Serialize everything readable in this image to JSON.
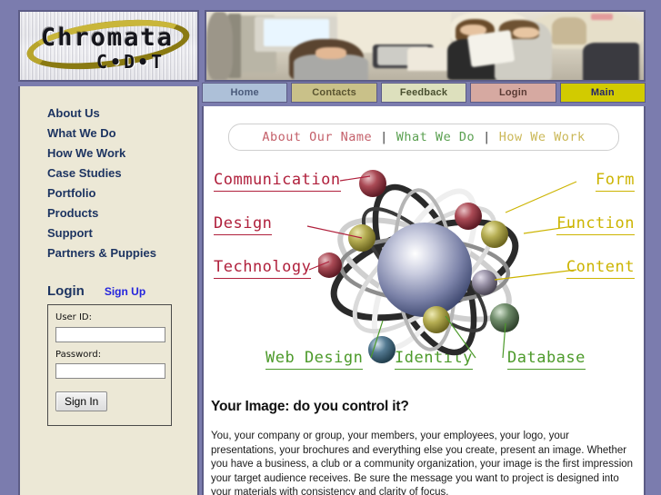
{
  "site": {
    "logo_word": "Chromata",
    "logo_sub": "C•D•T",
    "banner_alt": "office-photo-banner"
  },
  "colors": {
    "page_bg": "#7b7cae",
    "frame_border": "#5c5c86",
    "sidebar_bg": "#ece8d6",
    "nav_text": "#1d3461",
    "link": "#2424dd",
    "label_red": "#b0203c",
    "label_gold": "#ccb400",
    "label_green": "#4c9a2a"
  },
  "tabs": [
    {
      "label": "Home",
      "bg": "#adc0d8",
      "fg": "#4a5a7a"
    },
    {
      "label": "Contacts",
      "bg": "#c9c189",
      "fg": "#5a5430"
    },
    {
      "label": "Feedback",
      "bg": "#dde0bd",
      "fg": "#4a5030"
    },
    {
      "label": "Login",
      "bg": "#d6a9a1",
      "fg": "#5a3a34"
    },
    {
      "label": "Main",
      "bg": "#d2cb00",
      "fg": "#24246a"
    }
  ],
  "sidebar": {
    "items": [
      {
        "label": "About Us"
      },
      {
        "label": "What We Do"
      },
      {
        "label": "How We Work"
      },
      {
        "label": "Case Studies"
      },
      {
        "label": "Portfolio"
      },
      {
        "label": "Products"
      },
      {
        "label": "Support"
      },
      {
        "label": "Partners & Puppies"
      }
    ],
    "login": {
      "title": "Login",
      "signup_label": "Sign Up",
      "userid_label": "User ID:",
      "userid_value": "",
      "userid_placeholder": "",
      "password_label": "Password:",
      "password_value": "",
      "password_placeholder": "",
      "signin_label": "Sign In"
    }
  },
  "main": {
    "subnav": [
      {
        "label": "About Our Name",
        "color": "#c4606a"
      },
      {
        "label": "What We Do",
        "color": "#5aa050"
      },
      {
        "label": "How We Work",
        "color": "#cbb858"
      }
    ],
    "subnav_separator": "|",
    "graphic": {
      "name": "atom-diagram",
      "labels_left": [
        "Communication",
        "Design",
        "Technology"
      ],
      "labels_right": [
        "Form",
        "Function",
        "Content"
      ],
      "labels_bottom": [
        "Web Design",
        "Identity",
        "Database"
      ]
    },
    "headline": "Your Image: do you control it?",
    "body": "You, your company or group, your members, your employees, your logo, your presentations, your brochures and everything else you create, present an image. Whether you have a business, a club or a community organization, your image is the first impression your target audience receives. Be sure the message you want to project is designed into your materials with consistency and clarity of focus."
  }
}
